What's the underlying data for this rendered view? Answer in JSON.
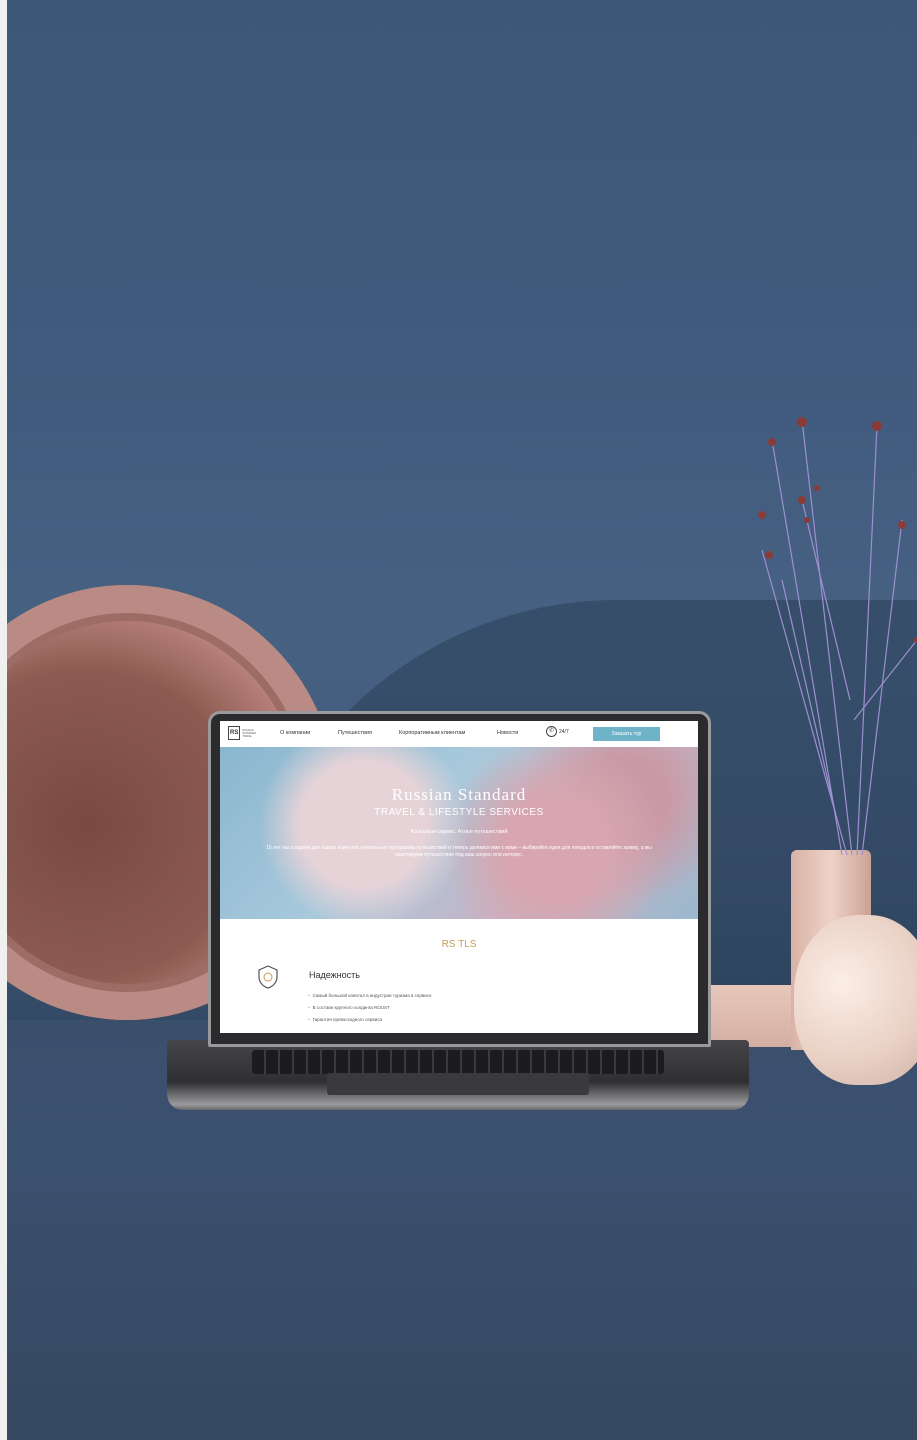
{
  "nav": {
    "logo_mark": "RS",
    "logo_small": "RUSSIAN STANDARD TRAVEL",
    "links": [
      "О компании",
      "Путешествия",
      "Корпоративным клиентам",
      "Новости"
    ],
    "phone": "24/7",
    "cta": "Заказать тур"
  },
  "hero": {
    "title": "Russian Standard",
    "subtitle": "TRAVEL & LIFESTYLE SERVICES",
    "tagline": "Консьерж-сервис. Атлье путешествий",
    "description": "15 лет мы создаем для наших клиентов уникальные программы путешествий и теперь делимся ими с вами – выбирайте идеи для поездок и оставляйте заявку, а мы адаптируем путешествие под ваш запрос или интерес."
  },
  "section": {
    "brand": "RS TLS",
    "feature_title": "Надежность",
    "bullets": [
      "Самый большой капитал в индустрии туризма в сервисе",
      "В составе крупного холдинга ROUST",
      "Гарантия превосходного сервиса"
    ]
  },
  "colors": {
    "accent": "#6fb3c8",
    "gold": "#c89a55",
    "wall": "#415b7e"
  }
}
